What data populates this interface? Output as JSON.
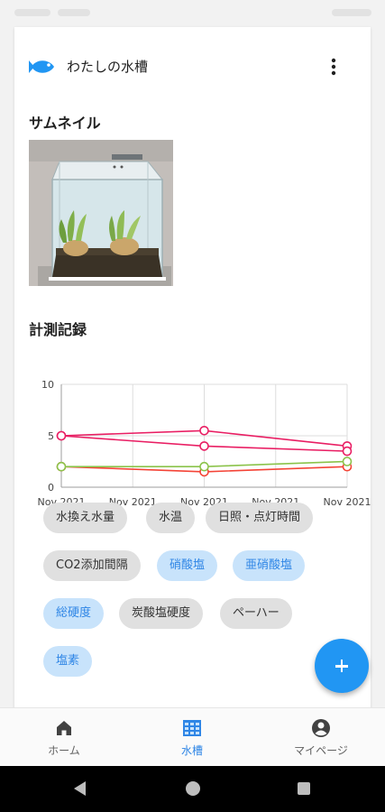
{
  "colors": {
    "accent": "#2196f3",
    "active_nav": "#2f86e6",
    "chip_selected_bg": "#c8e3fb",
    "chip_unselected_bg": "#e0e0e0",
    "series_pink": "#e91e63",
    "series_red": "#f44336",
    "series_green": "#8bc34a"
  },
  "header": {
    "title": "わたしの水槽",
    "logo_icon": "fish-icon",
    "menu_icon": "more-vert-icon"
  },
  "thumbnail": {
    "section_title": "サムネイル"
  },
  "measurement": {
    "section_title": "計測記録"
  },
  "chart_data": {
    "type": "line",
    "x": [
      "Nov 2021",
      "Nov 2021",
      "Nov 2021",
      "Nov 2021",
      "Nov 2021"
    ],
    "ylim": [
      0,
      10
    ],
    "y_ticks": [
      "0",
      "5",
      "10"
    ],
    "grid": true,
    "series": [
      {
        "color": "#e91e63",
        "points": [
          [
            0,
            5.0
          ],
          [
            2,
            5.5
          ],
          [
            4,
            4.0
          ]
        ]
      },
      {
        "color": "#e91e63",
        "points": [
          [
            0,
            5.0
          ],
          [
            2,
            4.0
          ],
          [
            4,
            3.5
          ]
        ]
      },
      {
        "color": "#f44336",
        "points": [
          [
            0,
            2.0
          ],
          [
            2,
            1.5
          ],
          [
            4,
            2.0
          ]
        ]
      },
      {
        "color": "#8bc34a",
        "points": [
          [
            0,
            2.0
          ],
          [
            2,
            2.0
          ],
          [
            4,
            2.5
          ]
        ]
      }
    ]
  },
  "chips": [
    {
      "label": "水換え水量",
      "selected": false
    },
    {
      "label": "水温",
      "selected": false
    },
    {
      "label": "日照・点灯時間",
      "selected": false
    },
    {
      "label": "CO2添加間隔",
      "selected": false
    },
    {
      "label": "硝酸塩",
      "selected": true
    },
    {
      "label": "亜硝酸塩",
      "selected": true
    },
    {
      "label": "総硬度",
      "selected": true
    },
    {
      "label": "炭酸塩硬度",
      "selected": false
    },
    {
      "label": "ペーハー",
      "selected": false
    },
    {
      "label": "塩素",
      "selected": true
    }
  ],
  "fab": {
    "icon": "plus-icon"
  },
  "bottom_nav": {
    "items": [
      {
        "label": "ホーム",
        "icon": "home-icon",
        "active": false
      },
      {
        "label": "水槽",
        "icon": "aquarium-icon",
        "active": true
      },
      {
        "label": "マイページ",
        "icon": "account-icon",
        "active": false
      }
    ]
  }
}
